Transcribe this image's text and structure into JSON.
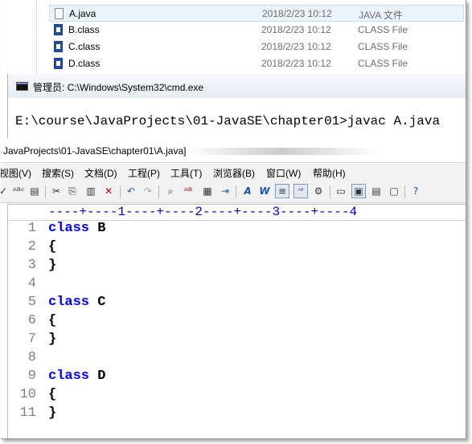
{
  "explorer": {
    "files": [
      {
        "name": "A.java",
        "date": "2018/2/23 10:12",
        "type": "JAVA 文件",
        "icon": "java-file-icon"
      },
      {
        "name": "B.class",
        "date": "2018/2/23 10:12",
        "type": "CLASS File",
        "icon": "class-file-icon"
      },
      {
        "name": "C.class",
        "date": "2018/2/23 10:12",
        "type": "CLASS File",
        "icon": "class-file-icon"
      },
      {
        "name": "D.class",
        "date": "2018/2/23 10:12",
        "type": "CLASS File",
        "icon": "class-file-icon"
      }
    ]
  },
  "cmd": {
    "title": "管理员: C:\\Windows\\System32\\cmd.exe",
    "command_line": "E:\\course\\JavaProjects\\01-JavaSE\\chapter01>javac A.java"
  },
  "editor": {
    "title": "JavaProjects\\01-JavaSE\\chapter01\\A.java]",
    "menu": [
      "视图(V)",
      "搜索(S)",
      "文档(D)",
      "工程(P)",
      "工具(T)",
      "浏览器(B)",
      "窗口(W)",
      "帮助(H)"
    ],
    "ruler": "----+----1----+----2----+----3----+----4",
    "lines": [
      {
        "num": "1",
        "keyword": "class",
        "rest": " B"
      },
      {
        "num": "2",
        "keyword": "",
        "rest": "{"
      },
      {
        "num": "3",
        "keyword": "",
        "rest": "}"
      },
      {
        "num": "4",
        "keyword": "",
        "rest": ""
      },
      {
        "num": "5",
        "keyword": "class",
        "rest": " C"
      },
      {
        "num": "6",
        "keyword": "",
        "rest": "{"
      },
      {
        "num": "7",
        "keyword": "",
        "rest": "}"
      },
      {
        "num": "8",
        "keyword": "",
        "rest": ""
      },
      {
        "num": "9",
        "keyword": "class",
        "rest": " D"
      },
      {
        "num": "10",
        "keyword": "",
        "rest": "{"
      },
      {
        "num": "11",
        "keyword": "",
        "rest": "}"
      }
    ],
    "colors": {
      "keyword": "#0000ff",
      "line_number": "#808080",
      "ruler": "#0000cc"
    }
  }
}
